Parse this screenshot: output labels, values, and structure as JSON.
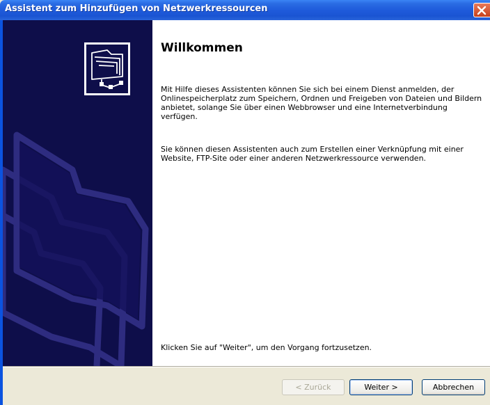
{
  "window": {
    "title": "Assistent zum Hinzufügen von Netzwerkressourcen",
    "close_icon": "close-icon"
  },
  "sidebar": {
    "icon": "network-folder-icon",
    "background_art": "folders-watermark"
  },
  "content": {
    "heading": "Willkommen",
    "paragraph1": "Mit Hilfe dieses Assistenten können Sie sich bei einem Dienst anmelden, der Onlinespeicherplatz zum Speichern, Ordnen und Freigeben von Dateien und Bildern anbietet, solange Sie über einen Webbrowser und eine Internetverbindung verfügen.",
    "paragraph2": "Sie können diesen Assistenten auch zum Erstellen einer Verknüpfung mit einer Website, FTP-Site oder einer anderen Netzwerkressource verwenden.",
    "footer": "Klicken Sie auf \"Weiter\", um den Vorgang fortzusetzen."
  },
  "buttons": {
    "back": "< Zurück",
    "next": "Weiter >",
    "cancel": "Abbrechen"
  },
  "colors": {
    "titlebar": "#1F5BDB",
    "sidebar": "#0E0E4A",
    "dialog_bg": "#ECE9D8"
  }
}
